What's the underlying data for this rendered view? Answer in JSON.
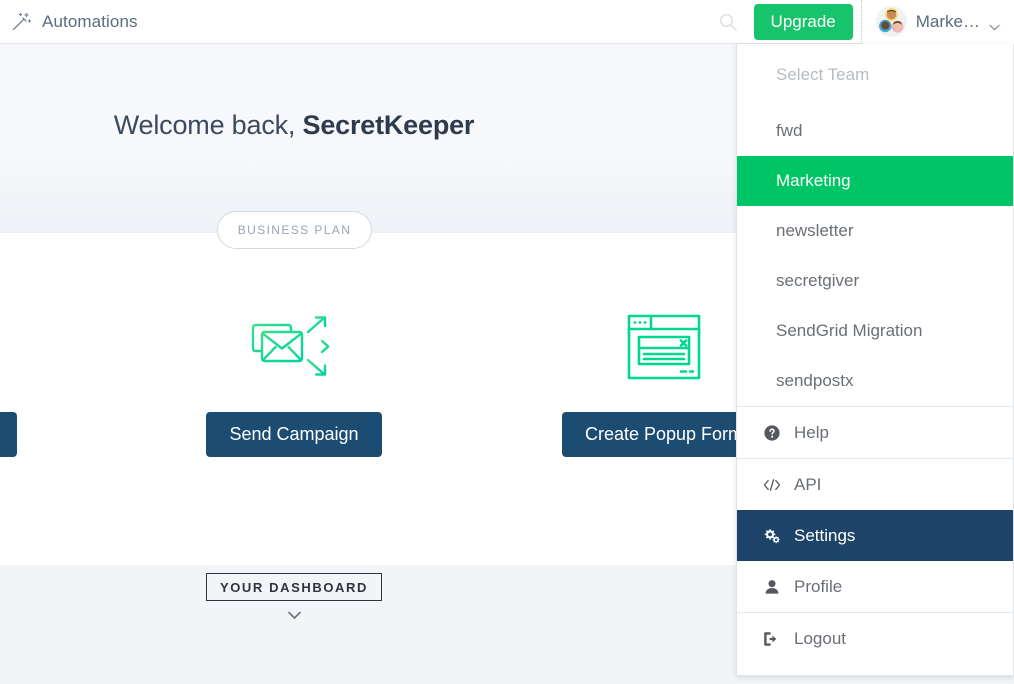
{
  "header": {
    "logo_icon": "magic-wand-icon",
    "title": "Automations",
    "search_icon": "search-icon",
    "upgrade_label": "Upgrade",
    "avatar_icon": "team-avatar",
    "team_name": "Marke…",
    "caret_icon": "chevron-down-icon"
  },
  "hero": {
    "welcome_prefix": "Welcome back, ",
    "welcome_user": "SecretKeeper",
    "plan_badge": "BUSINESS PLAN",
    "tiles": [
      {
        "icon": "envelopes-send-icon",
        "button_label": "Send Campaign"
      },
      {
        "icon": "popup-form-icon",
        "button_label": "Create Popup Form"
      },
      {
        "icon": "hidden-icon",
        "button_label": ""
      }
    ],
    "dashboard_label": "YOUR DASHBOARD",
    "dashboard_chevron_icon": "chevron-down-icon"
  },
  "dropdown": {
    "section_label": "Select Team",
    "teams": [
      {
        "name": "fwd",
        "active": false
      },
      {
        "name": "Marketing",
        "active": true
      },
      {
        "name": "newsletter",
        "active": false
      },
      {
        "name": "secretgiver",
        "active": false
      },
      {
        "name": "SendGrid Migration",
        "active": false
      },
      {
        "name": "sendpostx",
        "active": false
      }
    ],
    "items": [
      {
        "label": "Help",
        "icon": "help-circle-icon",
        "selected": false
      },
      {
        "label": "API",
        "icon": "code-brackets-icon",
        "selected": false
      },
      {
        "label": "Settings",
        "icon": "gears-icon",
        "selected": true
      },
      {
        "label": "Profile",
        "icon": "user-icon",
        "selected": false
      },
      {
        "label": "Logout",
        "icon": "logout-arrow-icon",
        "selected": false
      }
    ]
  },
  "colors": {
    "accent_green": "#18c46b",
    "team_active_green": "#00c566",
    "dark_navy": "#1d4c72",
    "selected_navy": "#1d4368",
    "icon_green": "#00d78f",
    "hero_gray": "#f6f8fb"
  }
}
